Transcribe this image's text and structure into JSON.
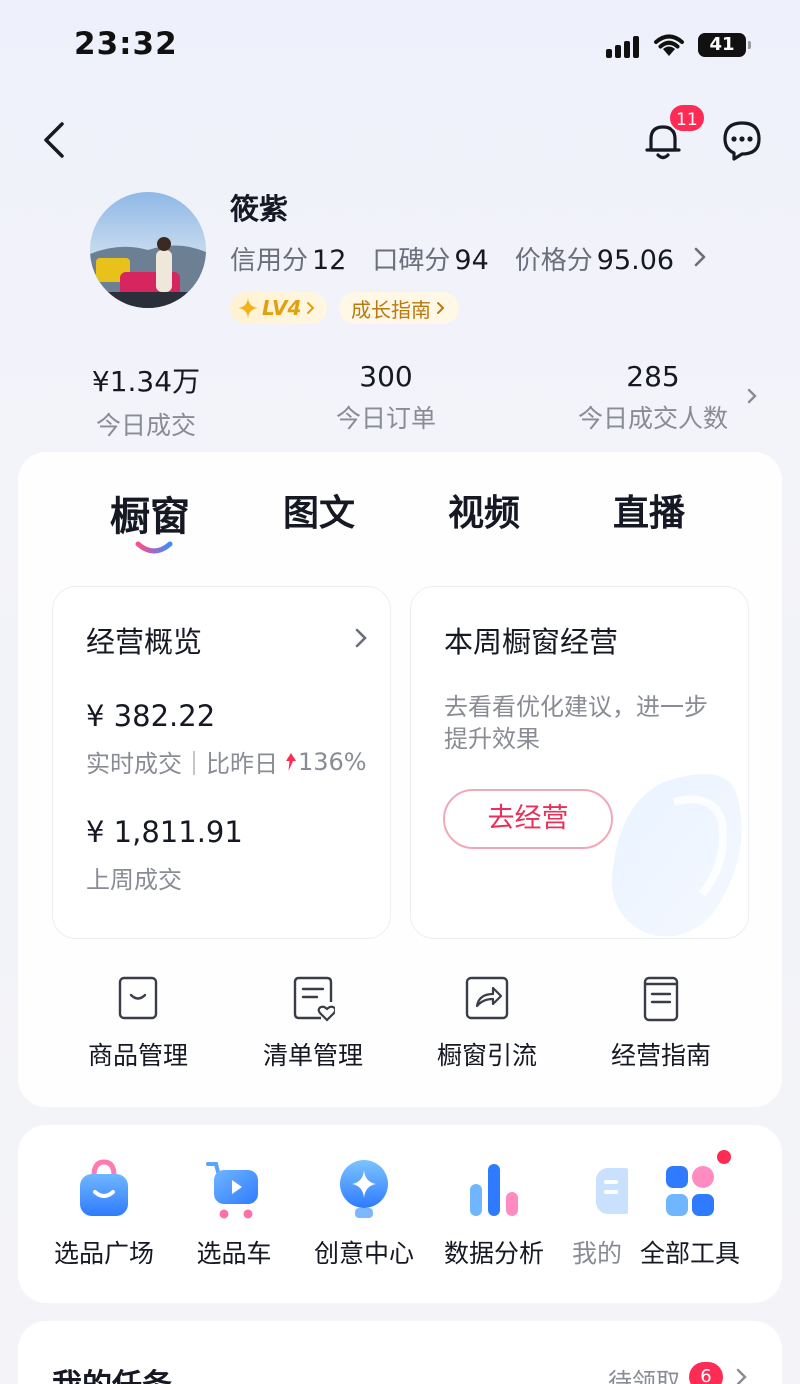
{
  "status_bar": {
    "time": "23:32",
    "battery": "41"
  },
  "nav": {
    "notification_count": "11"
  },
  "profile": {
    "name": "筱紫",
    "scores": [
      {
        "label": "信用分",
        "value": "12"
      },
      {
        "label": "口碑分",
        "value": "94"
      },
      {
        "label": "价格分",
        "value": "95.06"
      }
    ],
    "level": "LV4",
    "growth_guide": "成长指南"
  },
  "stats": [
    {
      "value": "¥1.34万",
      "label": "今日成交"
    },
    {
      "value": "300",
      "label": "今日订单"
    },
    {
      "value": "285",
      "label": "今日成交人数"
    }
  ],
  "tabs": [
    "橱窗",
    "图文",
    "视频",
    "直播"
  ],
  "overview": {
    "title": "经营概览",
    "realtime_value": "¥ 382.22",
    "realtime_label": "实时成交｜比昨日",
    "realtime_change": "136%",
    "lastweek_value": "¥ 1,811.91",
    "lastweek_label": "上周成交"
  },
  "weekly": {
    "title": "本周橱窗经营",
    "desc": "去看看优化建议，进一步提升效果",
    "button": "去经营"
  },
  "tools": [
    {
      "label": "商品管理",
      "icon": "bag-icon"
    },
    {
      "label": "清单管理",
      "icon": "list-heart-icon"
    },
    {
      "label": "橱窗引流",
      "icon": "share-icon"
    },
    {
      "label": "经营指南",
      "icon": "guide-doc-icon"
    }
  ],
  "quick_tools": [
    {
      "label": "选品广场",
      "icon": "shopping-bag-icon"
    },
    {
      "label": "选品车",
      "icon": "cart-icon"
    },
    {
      "label": "创意中心",
      "icon": "bulb-icon"
    },
    {
      "label": "数据分析",
      "icon": "bar-chart-icon"
    },
    {
      "label": "我的",
      "icon": "partial-icon"
    },
    {
      "label": "全部工具",
      "icon": "grid-icon"
    }
  ],
  "tasks": {
    "title": "我的任务",
    "pending_label": "待领取",
    "pending_count": "6"
  },
  "colors": {
    "accent": "#fe2c55",
    "gold": "#e0a012",
    "blue": "#3a8bff"
  }
}
